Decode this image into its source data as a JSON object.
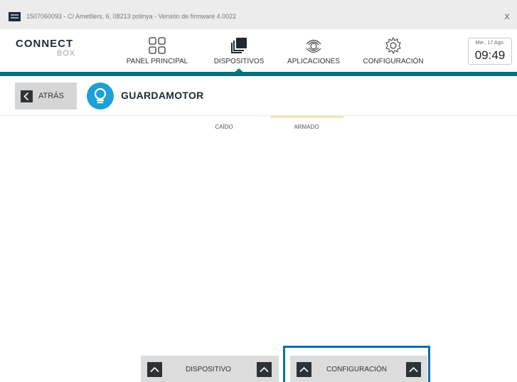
{
  "window": {
    "title": "1507060093 - C/ Ametllers, 6, 08213 polinya - Versión de firmware 4.0022",
    "close_label": "X"
  },
  "brand": {
    "line1": "CONNECT",
    "line2": "BOX"
  },
  "nav": {
    "items": [
      {
        "label": "PANEL PRINCIPAL",
        "icon": "grid-icon",
        "active": false
      },
      {
        "label": "DISPOSITIVOS",
        "icon": "devices-icon",
        "active": true
      },
      {
        "label": "APLICACIONES",
        "icon": "apps-icon",
        "active": false
      },
      {
        "label": "CONFIGURACIÓN",
        "icon": "gear-icon",
        "active": false
      }
    ]
  },
  "clock": {
    "date": "Mie., 17 Ago.",
    "time": "09:49"
  },
  "subheader": {
    "back_label": "ATRÁS",
    "device_title": "GUARDAMOTOR",
    "device_icon": "bulb-icon"
  },
  "states": {
    "caido": "CAÍDO",
    "armado": "ARMADO"
  },
  "bottom": {
    "device_panel_label": "DISPOSITIVO",
    "config_panel_label": "CONFIGURACIÓN"
  },
  "colors": {
    "accent": "#0b6e7a",
    "device_icon_bg": "#1ba0d8",
    "highlight": "#0a6db5",
    "panel_bg": "#dcdcdc"
  }
}
